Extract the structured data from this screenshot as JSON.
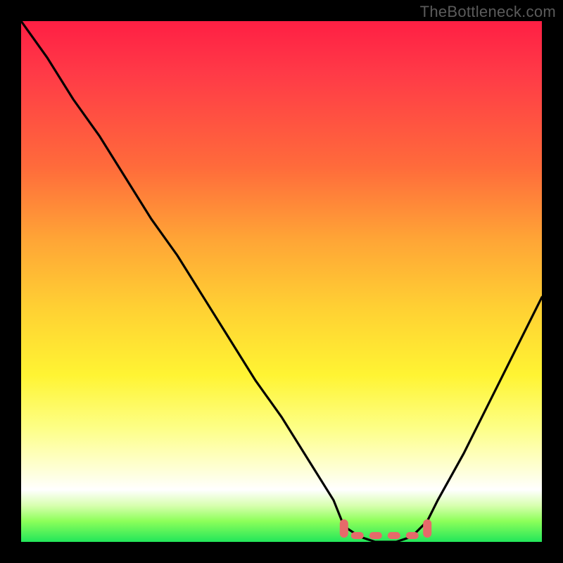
{
  "watermark": "TheBottleneck.com",
  "colors": {
    "background": "#000000",
    "curve": "#000000",
    "optimal_marker": "#e66a6a",
    "gradient_top": "#ff1f44",
    "gradient_mid": "#ffd033",
    "gradient_bottom": "#22e65a"
  },
  "chart_data": {
    "type": "line",
    "title": "",
    "xlabel": "",
    "ylabel": "",
    "xlim": [
      0,
      100
    ],
    "ylim": [
      0,
      100
    ],
    "x": [
      0,
      5,
      10,
      15,
      20,
      25,
      30,
      35,
      40,
      45,
      50,
      55,
      60,
      62,
      65,
      68,
      70,
      72,
      75,
      78,
      80,
      85,
      90,
      95,
      100
    ],
    "values": [
      100,
      93,
      85,
      78,
      70,
      62,
      55,
      47,
      39,
      31,
      24,
      16,
      8,
      3,
      1,
      0,
      0,
      0,
      1,
      4,
      8,
      17,
      27,
      37,
      47
    ],
    "optimal_range_x": [
      62,
      78
    ],
    "annotations": []
  }
}
